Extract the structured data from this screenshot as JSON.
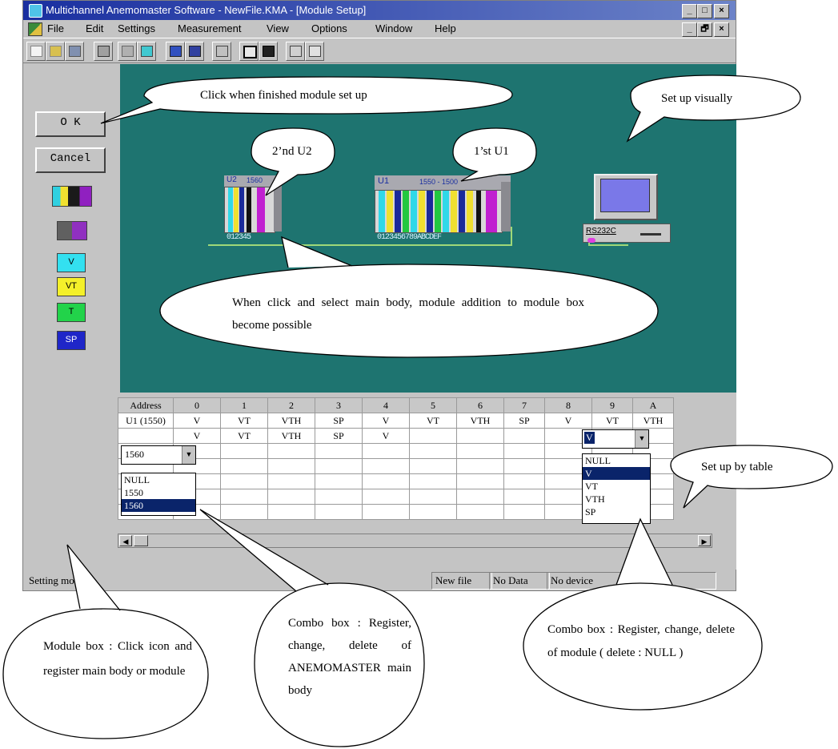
{
  "window": {
    "title": "Multichannel Anemomaster Software - NewFile.KMA - [Module Setup]",
    "controls": [
      "_",
      "□",
      "×"
    ],
    "mdi_controls": [
      "_",
      "🗗",
      "×"
    ]
  },
  "menu": [
    "File",
    "Edit",
    "Settings",
    "Measurement",
    "View",
    "Options",
    "Window",
    "Help"
  ],
  "left_panel": {
    "ok_label": "O K",
    "cancel_label": "Cancel",
    "module_icons": [
      {
        "label": "",
        "name": "main-body-icon"
      },
      {
        "label": "",
        "name": "module-icon"
      },
      {
        "label": "V",
        "color": "#33e0f0"
      },
      {
        "label": "VT",
        "color": "#f4f02a"
      },
      {
        "label": "T",
        "color": "#22d34a"
      },
      {
        "label": "SP",
        "color": "#1f26c8"
      }
    ]
  },
  "canvas": {
    "unit2": {
      "label": "U2",
      "model": "1560",
      "channels": "012345"
    },
    "unit1": {
      "label": "U1",
      "model": "1550 - 1500",
      "channels": "0123456789ABCDEF"
    },
    "pc": {
      "label": "RS232C"
    }
  },
  "table": {
    "headers": [
      "Address",
      "0",
      "1",
      "2",
      "3",
      "4",
      "5",
      "6",
      "7",
      "8",
      "9",
      "A"
    ],
    "rows": [
      [
        "U1 (1550)",
        "V",
        "VT",
        "VTH",
        "SP",
        "V",
        "VT",
        "VTH",
        "SP",
        "V",
        "VT",
        "VTH"
      ],
      [
        "1560",
        "V",
        "VT",
        "VTH",
        "SP",
        "V",
        "",
        "",
        "",
        "",
        "",
        ""
      ]
    ],
    "body_combo": {
      "value": "1560",
      "options": [
        "NULL",
        "1550",
        "1560"
      ],
      "selected": "1560"
    },
    "module_combo": {
      "value": "V",
      "options": [
        "NULL",
        "V",
        "VT",
        "VTH",
        "SP"
      ],
      "selected": "V"
    }
  },
  "status_bar": {
    "main": "Setting modules",
    "file": "New file",
    "data": "No Data",
    "device": "No device"
  },
  "callouts": {
    "ok": "Click when finished module set up",
    "visual": "Set up visually",
    "second": "2’nd U2",
    "first": "1’st U1",
    "body_select": "When click and select main body, module addition to module box become possible",
    "table": "Set up by table",
    "module_box": "Module box : Click icon and register main body or module",
    "body_combo": "Combo box : Register, change, delete of ANEMOMASTER main body",
    "module_combo": "Combo box : Register, change, delete of module ( delete : NULL )"
  }
}
